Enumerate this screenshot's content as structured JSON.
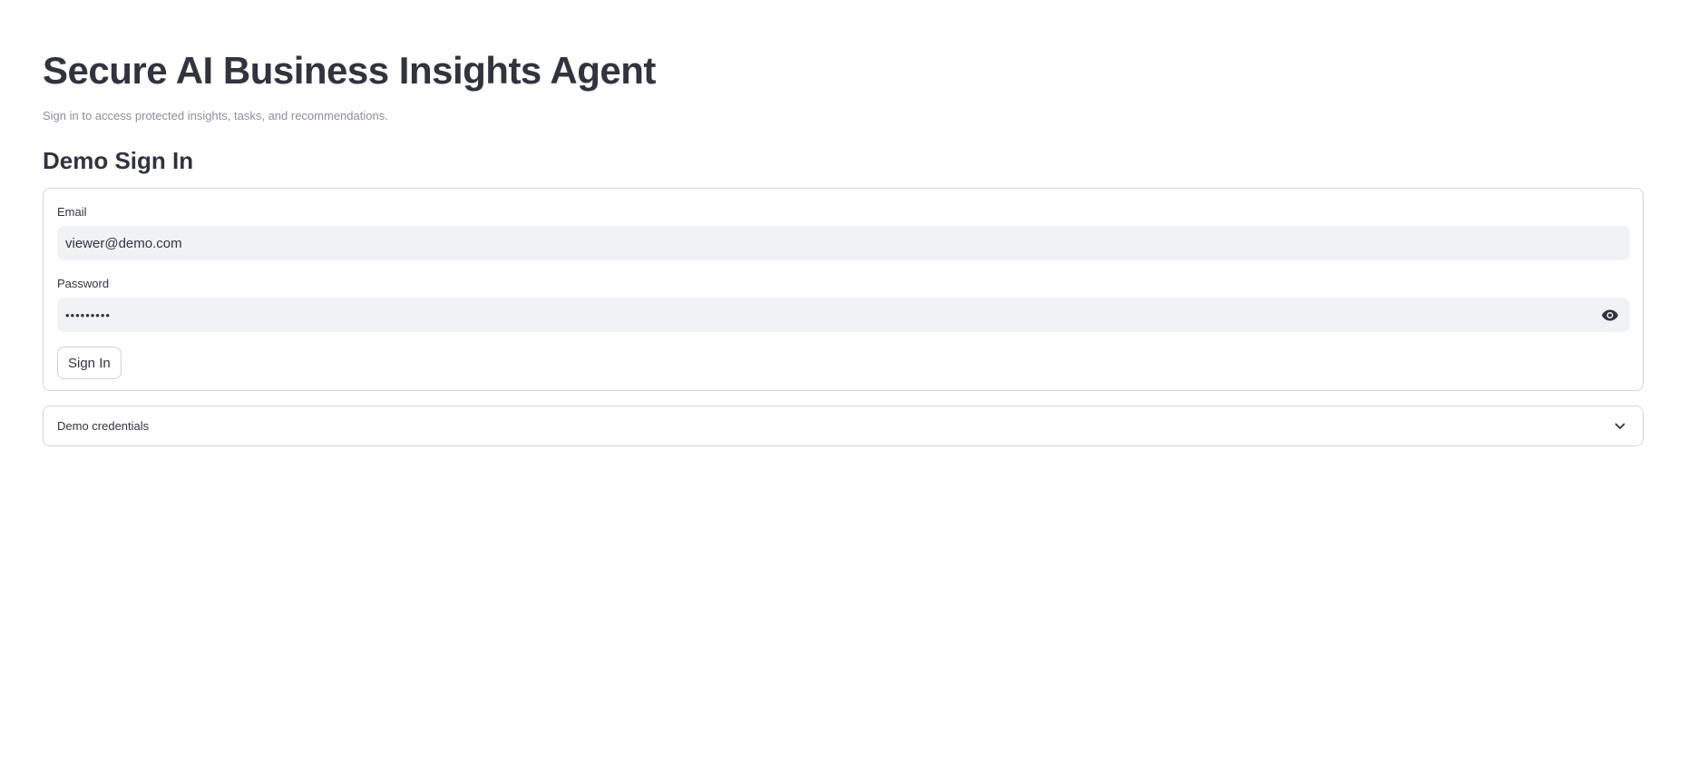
{
  "header": {
    "title": "Secure AI Business Insights Agent",
    "caption": "Sign in to access protected insights, tasks, and recommendations."
  },
  "signin": {
    "section_title": "Demo Sign In",
    "email_label": "Email",
    "email_value": "viewer@demo.com",
    "password_label": "Password",
    "password_masked": "•••••••••",
    "show_password_icon": "eye-icon",
    "button_label": "Sign In"
  },
  "expander": {
    "label": "Demo credentials",
    "icon": "chevron-down-icon",
    "expanded": false
  },
  "colors": {
    "text": "#31333f",
    "caption": "#8c8e97",
    "input_bg": "#f0f2f6",
    "border": "#d6d6d9",
    "background": "#ffffff"
  }
}
